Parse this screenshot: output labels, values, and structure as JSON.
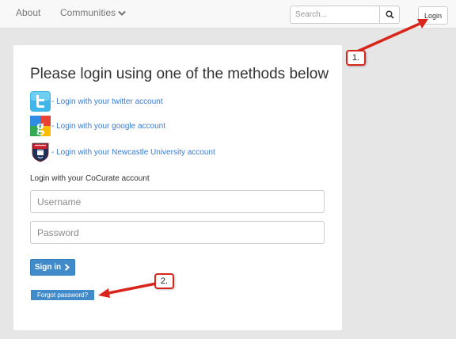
{
  "nav": {
    "about": "About",
    "communities": "Communities",
    "search_placeholder": "Search...",
    "login": "Login"
  },
  "login_card": {
    "title": "Please login using one of the methods below",
    "providers": [
      {
        "icon": "twitter-icon",
        "label": "- Login with your twitter account"
      },
      {
        "icon": "google-icon",
        "label": "- Login with your google account"
      },
      {
        "icon": "newcastle-university-crest-icon",
        "label": "- Login with your Newcastle University account"
      }
    ],
    "account_label": "Login with your CoCurate account",
    "username_placeholder": "Username",
    "password_placeholder": "Password",
    "sign_in": "Sign in",
    "forgot_password": "Forgot password?"
  },
  "annotations": {
    "callout_1": "1.",
    "callout_2": "2.",
    "arrow_color": "#d9261c"
  },
  "colors": {
    "accent": "#428bca",
    "link": "#3a7bd5",
    "background": "#e6e6e6"
  }
}
